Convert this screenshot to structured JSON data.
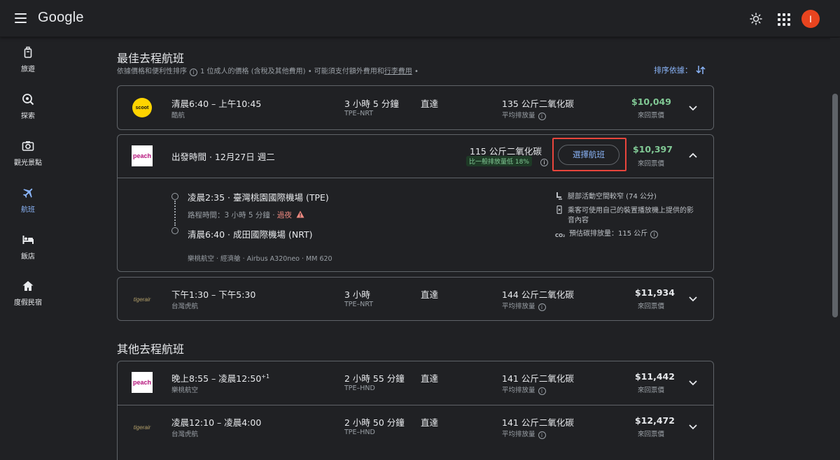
{
  "header": {
    "logo": "Google",
    "avatar_letter": "I",
    "icons": [
      "menu-icon",
      "theme-icon",
      "apps-icon"
    ]
  },
  "sidebar": {
    "items": [
      {
        "label": "旅遊",
        "icon": "luggage-icon"
      },
      {
        "label": "探索",
        "icon": "explore-icon"
      },
      {
        "label": "觀光景點",
        "icon": "camera-icon"
      },
      {
        "label": "航班",
        "icon": "plane-icon",
        "active": true
      },
      {
        "label": "飯店",
        "icon": "bed-icon"
      },
      {
        "label": "度假民宿",
        "icon": "home-icon"
      }
    ]
  },
  "best": {
    "title": "最佳去程航班",
    "sub_prefix": "依據價格和便利性排序",
    "sub_middle": "1 位成人的價格 (含稅及其他費用) • 可能須支付額外費用和",
    "sub_link": "行李費用",
    "sub_suffix": " •",
    "sort_label": "排序依據："
  },
  "other": {
    "title": "其他去程航班"
  },
  "flights": {
    "f1": {
      "logo": "scoot",
      "times": "清晨6:40 – 上午10:45",
      "airline": "酷航",
      "duration": "3 小時 5 分鐘",
      "route": "TPE–NRT",
      "stops": "直達",
      "co2": "135 公斤二氧化碳",
      "co2_sub": "平均排放量",
      "price": "$10,049",
      "price_sub": "來回票價"
    },
    "f2": {
      "logo": "peach",
      "departure": "出發時間 · 12月27日 週二",
      "co2": "115 公斤二氧化碳",
      "eco_badge": "比一般排放量低 18%",
      "select_label": "選擇航班",
      "price": "$10,397",
      "price_sub": "來回票價",
      "dep_line": "凌晨2:35 · 臺灣桃園國際機場 (TPE)",
      "travel_prefix": "路程時間：3 小時 5 分鐘 · ",
      "overnight": "過夜",
      "arr_line": "清晨6:40 · 成田國際機場 (NRT)",
      "details": "樂桃航空 · 經濟艙 · Airbus A320neo · MM 620",
      "amenity1": "腿部活動空間較窄 (74 公分)",
      "amenity2a": "乘客可使用自己的裝置播放機上提供的影",
      "amenity2b": "音內容",
      "amenity3": "預估碳排放量：115 公斤"
    },
    "f3": {
      "logo": "tigerair",
      "times": "下午1:30 – 下午5:30",
      "airline": "台灣虎航",
      "duration": "3 小時",
      "route": "TPE–NRT",
      "stops": "直達",
      "co2": "144 公斤二氧化碳",
      "co2_sub": "平均排放量",
      "price": "$11,934",
      "price_sub": "來回票價"
    },
    "f4": {
      "logo": "peach",
      "times": "晚上8:55 – 凌晨12:50",
      "times_sup": "+1",
      "airline": "樂桃航空",
      "duration": "2 小時 55 分鐘",
      "route": "TPE–HND",
      "stops": "直達",
      "co2": "141 公斤二氧化碳",
      "co2_sub": "平均排放量",
      "price": "$11,442",
      "price_sub": "來回票價"
    },
    "f5": {
      "logo": "tigerair",
      "times": "凌晨12:10 – 凌晨4:00",
      "airline": "台灣虎航",
      "duration": "2 小時 50 分鐘",
      "route": "TPE–HND",
      "stops": "直達",
      "co2": "141 公斤二氧化碳",
      "co2_sub": "平均排放量",
      "price": "$12,472",
      "price_sub": "來回票價"
    }
  },
  "logos": {
    "scoot": "scoot",
    "peach": "peach",
    "tigerair": "tigerair"
  },
  "colors": {
    "accent": "#8ab4f8",
    "green_price": "#81c995",
    "highlight": "#e8453c",
    "avatar": "#e8441f"
  }
}
